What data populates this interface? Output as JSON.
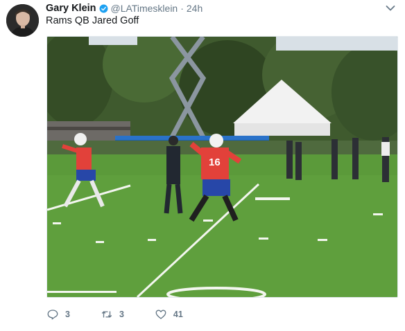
{
  "tweet": {
    "author_name": "Gary Klein",
    "handle": "@LATimesklein",
    "separator": "·",
    "timestamp": "24h",
    "text": "Rams QB Jared Goff",
    "verified": true
  },
  "media": {
    "jersey_front": "16",
    "icons": [
      "football-field-photo"
    ]
  },
  "actions": {
    "reply_count": "3",
    "retweet_count": "3",
    "like_count": "41"
  },
  "colors": {
    "text_primary": "#14171a",
    "text_secondary": "#657786",
    "verified_blue": "#1da1f2",
    "field_green": "#5b9a3a",
    "jersey_red": "#e2413a",
    "tent_white": "#f2f2f2",
    "tarp_blue": "#1a5fb4"
  }
}
